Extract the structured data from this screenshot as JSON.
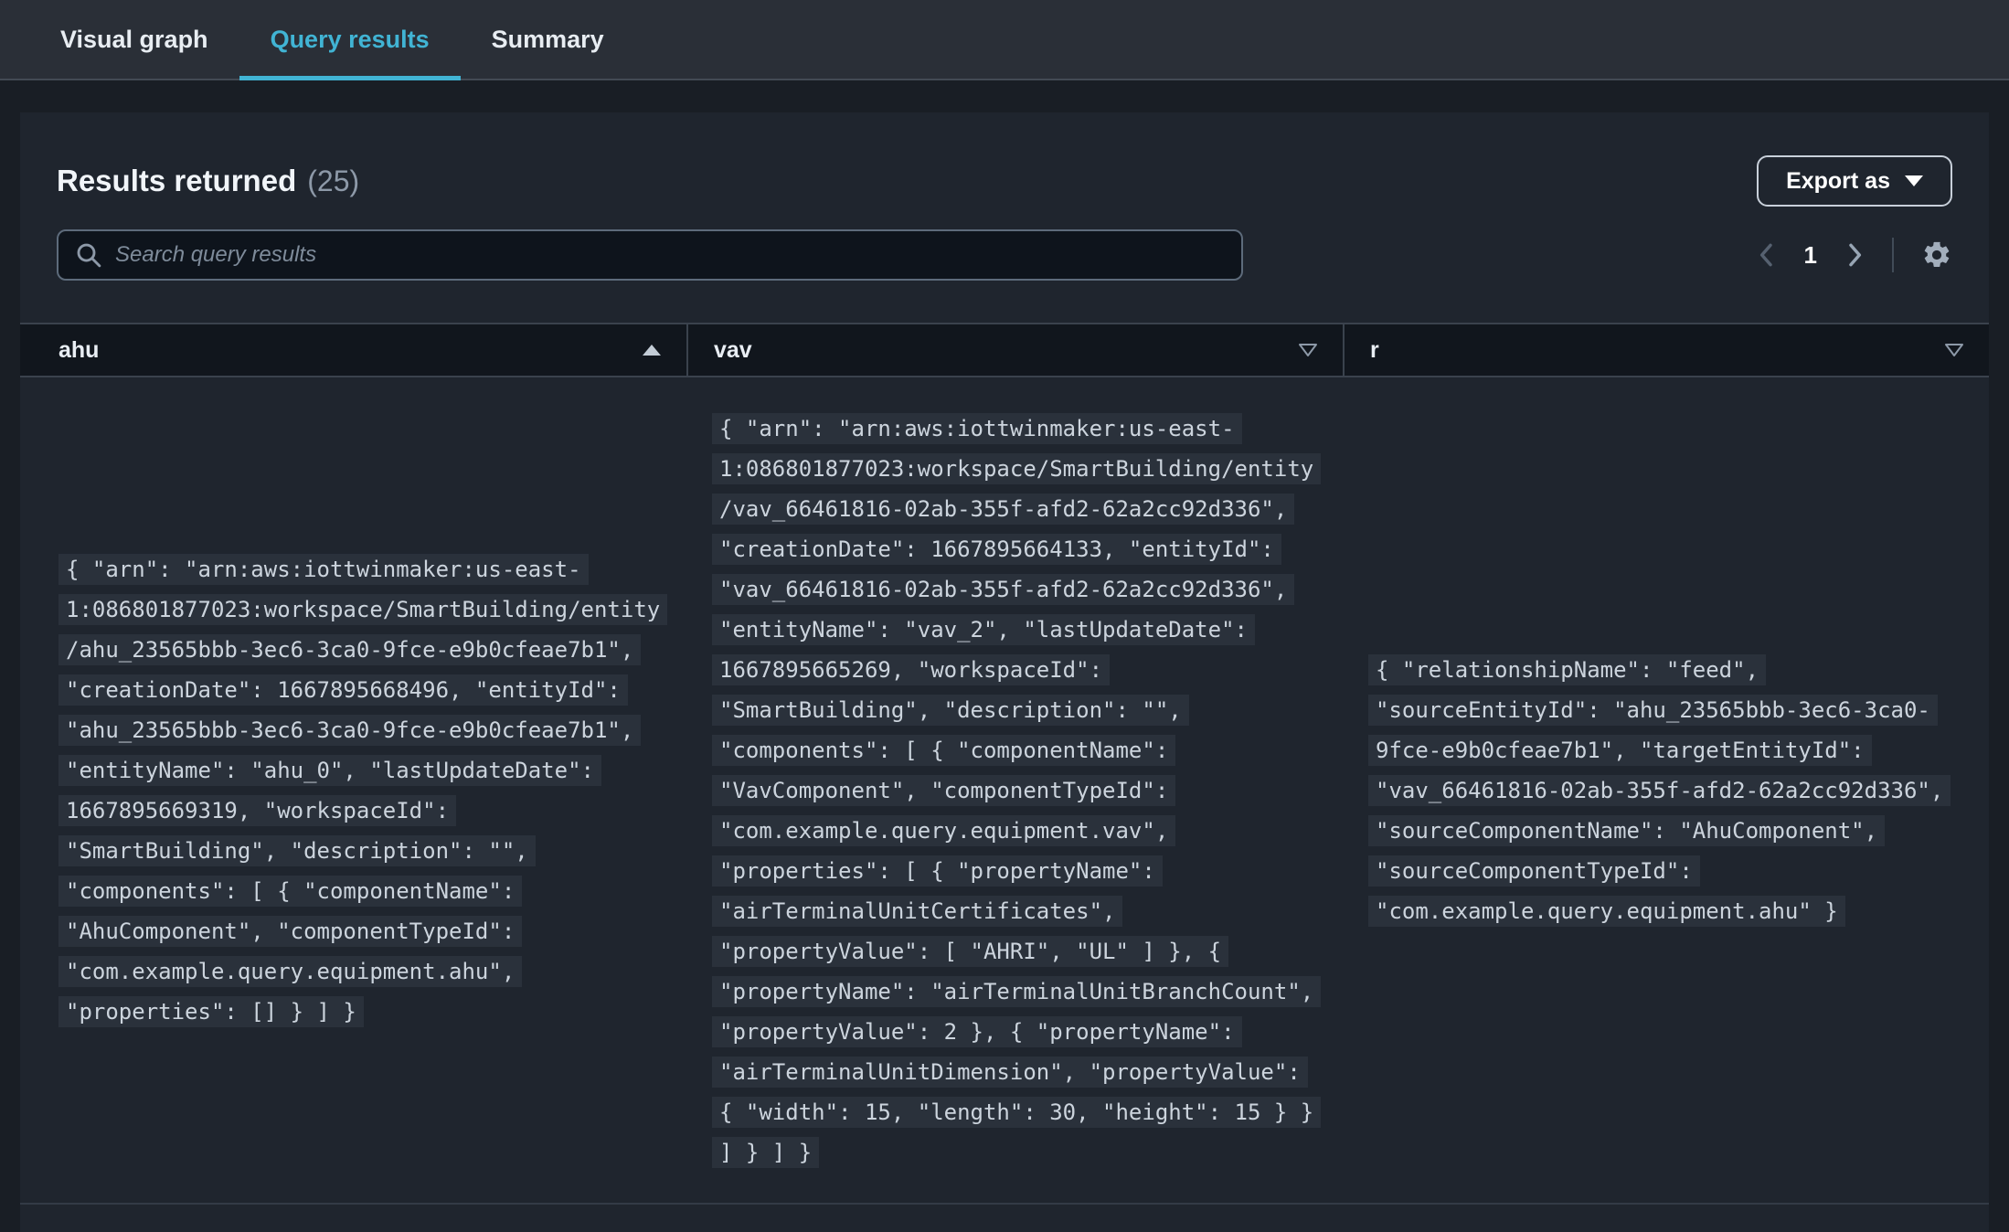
{
  "tabs": [
    {
      "label": "Visual graph",
      "active": false
    },
    {
      "label": "Query results",
      "active": true
    },
    {
      "label": "Summary",
      "active": false
    }
  ],
  "panel": {
    "title": "Results returned",
    "count_label": "(25)",
    "export_button": "Export as",
    "search": {
      "placeholder": "Search query results",
      "value": ""
    },
    "pagination": {
      "current_page": "1"
    }
  },
  "table": {
    "columns": [
      {
        "key": "ahu",
        "label": "ahu",
        "sort": "sorted-ascending"
      },
      {
        "key": "vav",
        "label": "vav",
        "sort": "sortable"
      },
      {
        "key": "r",
        "label": "r",
        "sort": "sortable"
      }
    ],
    "rows": [
      {
        "ahu": "{ \"arn\": \"arn:aws:iottwinmaker:us-east-1:086801877023:workspace/SmartBuilding/entity/ahu_23565bbb-3ec6-3ca0-9fce-e9b0cfeae7b1\", \"creationDate\": 1667895668496, \"entityId\": \"ahu_23565bbb-3ec6-3ca0-9fce-e9b0cfeae7b1\", \"entityName\": \"ahu_0\", \"lastUpdateDate\": 1667895669319, \"workspaceId\": \"SmartBuilding\", \"description\": \"\", \"components\": [ { \"componentName\": \"AhuComponent\", \"componentTypeId\": \"com.example.query.equipment.ahu\", \"properties\": [] } ] }",
        "vav": "{ \"arn\": \"arn:aws:iottwinmaker:us-east-1:086801877023:workspace/SmartBuilding/entity/vav_66461816-02ab-355f-afd2-62a2cc92d336\", \"creationDate\": 1667895664133, \"entityId\": \"vav_66461816-02ab-355f-afd2-62a2cc92d336\", \"entityName\": \"vav_2\", \"lastUpdateDate\": 1667895665269, \"workspaceId\": \"SmartBuilding\", \"description\": \"\", \"components\": [ { \"componentName\": \"VavComponent\", \"componentTypeId\": \"com.example.query.equipment.vav\", \"properties\": [ { \"propertyName\": \"airTerminalUnitCertificates\", \"propertyValue\": [ \"AHRI\", \"UL\" ] }, { \"propertyName\": \"airTerminalUnitBranchCount\", \"propertyValue\": 2 }, { \"propertyName\": \"airTerminalUnitDimension\", \"propertyValue\": { \"width\": 15, \"length\": 30, \"height\": 15 } } ] } ] }",
        "r": "{ \"relationshipName\": \"feed\", \"sourceEntityId\": \"ahu_23565bbb-3ec6-3ca0-9fce-e9b0cfeae7b1\", \"targetEntityId\": \"vav_66461816-02ab-355f-afd2-62a2cc92d336\", \"sourceComponentName\": \"AhuComponent\", \"sourceComponentTypeId\": \"com.example.query.equipment.ahu\" }"
      }
    ]
  },
  "icons": {
    "search": "magnifier",
    "settings": "gear",
    "previous_page": "chevron-left",
    "next_page": "chevron-right",
    "sort_ascending": "filled-triangle-up",
    "sortable": "outline-triangle-down",
    "export_caret": "filled-triangle-down"
  },
  "colors": {
    "accent_tab": "#41b4d4",
    "panel_bg": "#1f252e",
    "header_bg": "#11161d",
    "json_highlight_bg": "#2a313b",
    "text_primary": "#f1f5f9",
    "text_muted": "#8d99a8"
  }
}
